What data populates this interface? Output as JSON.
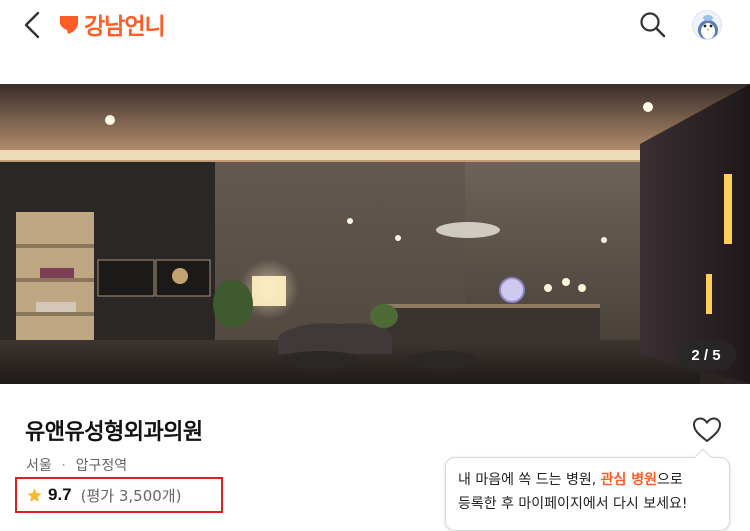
{
  "header": {
    "logo_text": "강남언니",
    "icons": {
      "back": "chevron-left-icon",
      "search": "search-icon",
      "avatar": "penguin-avatar"
    },
    "brand_color": "#ff5c26"
  },
  "hero": {
    "page_indicator": "2 / 5",
    "current_page": 2,
    "total_pages": 5
  },
  "clinic": {
    "name": "유앤유성형외과의원",
    "region": "서울",
    "separator": "·",
    "station": "압구정역",
    "rating": "9.7",
    "review_count": "(평가 3,500개)",
    "highlight_color": "#e01e1e"
  },
  "tooltip": {
    "line1_prefix": "내 마음에 쏙 드는 병원, ",
    "line1_highlight": "관심 병원",
    "line1_suffix": "으로",
    "line2": "등록한 후 마이페이지에서 다시 보세요!"
  }
}
